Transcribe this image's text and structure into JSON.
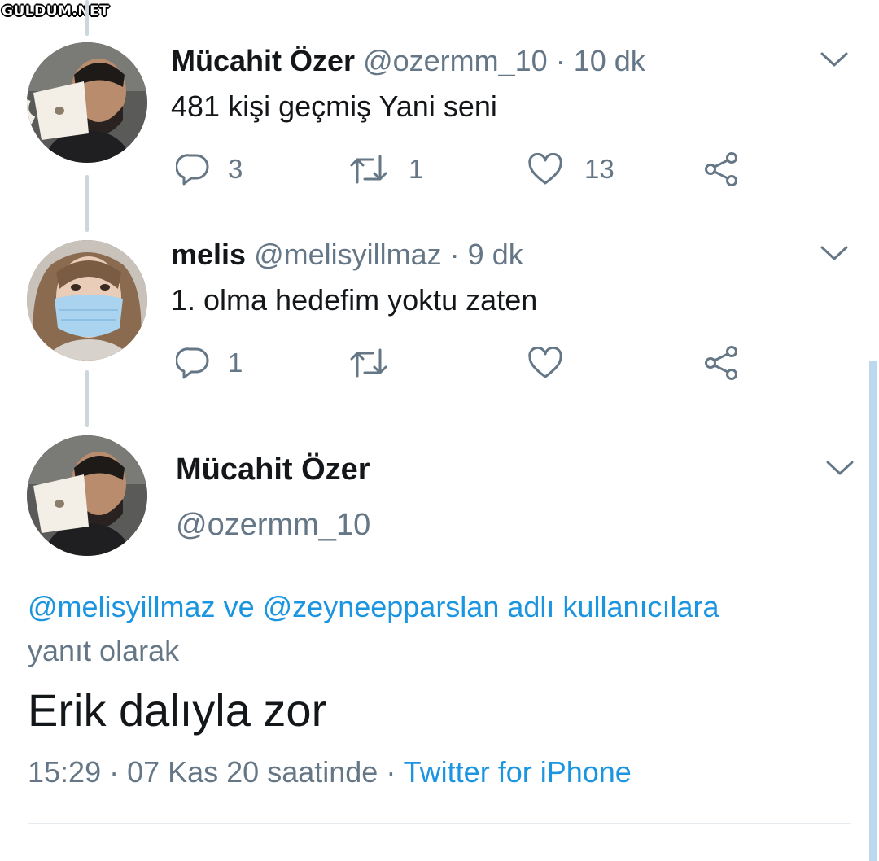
{
  "watermark": "GULDUM.NET",
  "tweets": [
    {
      "name": "Mücahit Özer",
      "handle": "@ozermm_10",
      "separator": "·",
      "time": "10 dk",
      "text": "481 kişi geçmiş Yani seni",
      "replies": "3",
      "retweets": "1",
      "likes": "13"
    },
    {
      "name": "melis",
      "handle": "@melisyillmaz",
      "separator": "·",
      "time": "9 dk",
      "text": "1. olma hedefim yoktu zaten",
      "replies": "1",
      "retweets": "",
      "likes": ""
    }
  ],
  "main_tweet": {
    "name": "Mücahit Özer",
    "handle": "@ozermm_10",
    "reply_to_user1": "@melisyillmaz",
    "reply_to_and": "ve",
    "reply_to_user2": "@zeyneepparslan",
    "reply_to_suffix": "adlı kullanıcılara",
    "reply_to_tail": "yanıt olarak",
    "text": "Erik dalıyla zor",
    "timestamp": "15:29 · 07 Kas 20 saatinde ·",
    "source": "Twitter for iPhone"
  },
  "icons": {
    "reply": "reply-icon",
    "retweet": "retweet-icon",
    "like": "heart-icon",
    "share": "share-icon",
    "more": "chevron-down-icon"
  },
  "colors": {
    "link": "#1b95e0",
    "muted": "#657786",
    "text": "#14171a"
  }
}
